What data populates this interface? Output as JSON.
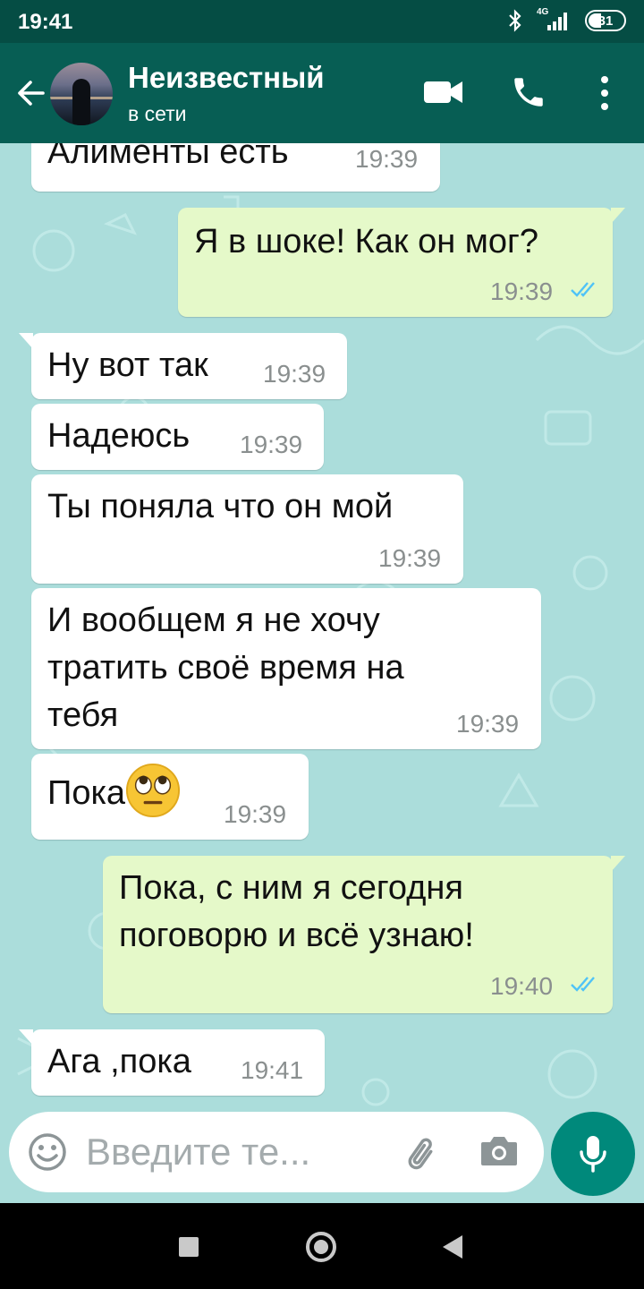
{
  "status_bar": {
    "time": "19:41",
    "network": "4G",
    "battery": "31"
  },
  "header": {
    "contact_name": "Неизвестный",
    "contact_status": "в сети"
  },
  "messages": [
    {
      "direction": "incoming",
      "text": "Алименты есть",
      "time": "19:39"
    },
    {
      "direction": "outgoing",
      "text": "Я в шоке! Как он мог?",
      "time": "19:39",
      "status": "read"
    },
    {
      "direction": "incoming",
      "text": "Ну вот так",
      "time": "19:39"
    },
    {
      "direction": "incoming",
      "text": "Надеюсь",
      "time": "19:39"
    },
    {
      "direction": "incoming",
      "text": "Ты поняла что он мой",
      "time": "19:39"
    },
    {
      "direction": "incoming",
      "lines": [
        "И вообщем я не хочу",
        "тратить своё время на",
        "тебя"
      ],
      "time": "19:39"
    },
    {
      "direction": "incoming",
      "text": "Пока",
      "emoji": "face-with-rolling-eyes",
      "time": "19:39"
    },
    {
      "direction": "outgoing",
      "lines": [
        "Пока, с ним я сегодня",
        "поговорю и всё узнаю!"
      ],
      "time": "19:40",
      "status": "read"
    },
    {
      "direction": "incoming",
      "text": "Ага ,пока",
      "time": "19:41"
    }
  ],
  "input": {
    "placeholder": "Введите те..."
  },
  "colors": {
    "header": "#075e54",
    "status_bar": "#054d44",
    "chat_bg": "#abdddb",
    "outgoing": "#e5f9c9",
    "incoming": "#ffffff",
    "accent": "#00897b",
    "read_ticks": "#4fc3f7"
  }
}
